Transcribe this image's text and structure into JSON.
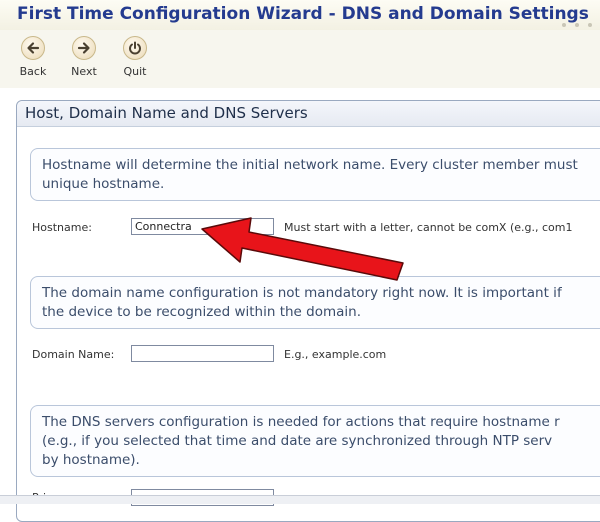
{
  "window": {
    "title": "First Time Configuration Wizard - DNS and Domain Settings"
  },
  "toolbar": {
    "back_label": "Back",
    "next_label": "Next",
    "quit_label": "Quit",
    "icons": {
      "back": "arrow-left-icon",
      "next": "arrow-right-icon",
      "quit": "power-icon"
    }
  },
  "section": {
    "title": "Host, Domain Name and DNS Servers",
    "hostname_info": {
      "line1": "Hostname will determine the initial network name. Every cluster member must",
      "line2": "unique hostname."
    },
    "hostname": {
      "label": "Hostname:",
      "value": "Connectra",
      "hint": "Must start with a letter, cannot be comX (e.g., com1"
    },
    "domain_info": {
      "line1": "The domain name configuration is not mandatory right now. It is important if",
      "line2": "the device to be recognized within the domain."
    },
    "domain": {
      "label": "Domain Name:",
      "value": "",
      "hint": "E.g., example.com"
    },
    "dns_info": {
      "line1": "The DNS servers configuration is needed for actions that require hostname r",
      "line2": "(e.g., if you selected that time and date are synchronized through NTP serv",
      "line3": "by hostname)."
    },
    "primary": {
      "label": "Prim",
      "value": ""
    }
  },
  "annotation": {
    "color": "#e8141a",
    "outline": "#5a0a0a"
  }
}
